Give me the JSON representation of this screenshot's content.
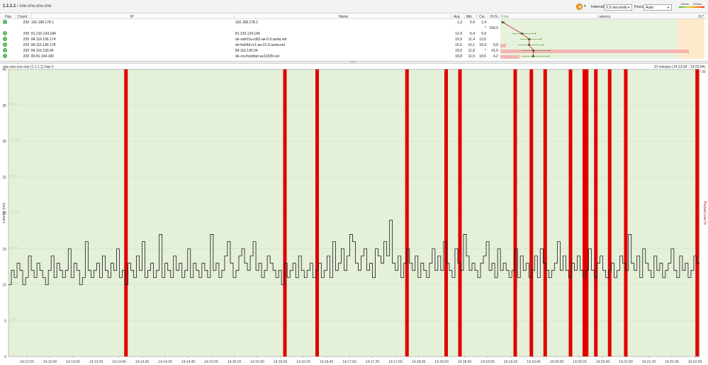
{
  "toolbar": {
    "title_bold": "1.1.1.1",
    "title_rest": " / one.one.one.one",
    "interval_label": "Interval",
    "interval_value": "2.5 seconds",
    "focus_label": "Focus",
    "focus_value": "Auto",
    "scale_100": "100ms",
    "scale_200": "200ms",
    "accent_color": "#f39c12"
  },
  "table": {
    "headers": {
      "hop": "Hop",
      "count": "Count",
      "ip": "IP",
      "name": "Name",
      "avg": "Avg",
      "min": "Min",
      "cur": "Cur",
      "pl": "PL%",
      "zero_ms": "0 ms",
      "latency": "Latency",
      "max_ms": "117"
    },
    "rows": [
      {
        "hop": "1",
        "count": "239",
        "ip": "192.168.178.1",
        "name": "192.168.178.1",
        "avg": "1,3",
        "min": "0,4",
        "cur": "1,4",
        "pl": ""
      },
      {
        "hop": "",
        "count": "",
        "ip": "-",
        "name": "",
        "avg": "",
        "min": "",
        "cur": "*",
        "pl": "100,0"
      },
      {
        "hop": "3",
        "count": "239",
        "ip": "81.210.134.184",
        "name": "81.210.134.184",
        "avg": "12,4",
        "min": "6,4",
        "cur": "9,9",
        "pl": ""
      },
      {
        "hop": "4",
        "count": "239",
        "ip": "84.116.196.174",
        "name": "de-sah01a-rd02-ae-0-0.aorta.net",
        "avg": "16,6",
        "min": "11,4",
        "cur": "13,6",
        "pl": ""
      },
      {
        "hop": "5",
        "count": "239",
        "ip": "84.116.196.178",
        "name": "de-fra04d-rc1-ae-21-0.aorta.net",
        "avg": "16,5",
        "min": "10,1",
        "cur": "16,9",
        "pl": "0,8"
      },
      {
        "hop": "6",
        "count": "239",
        "ip": "84.116.190.94",
        "name": "84.116.190.94",
        "avg": "19,0",
        "min": "11,8",
        "cur": "*",
        "pl": "41,5"
      },
      {
        "hop": "7",
        "count": "239",
        "ip": "80.81.194.180",
        "name": "de-cix-frankfurt.as13335.net",
        "avg": "18,8",
        "min": "11,9",
        "cur": "18,5",
        "pl": "4,2"
      }
    ]
  },
  "chart_header": {
    "title": "one.one.one.one (1.1.1.1) hop 0",
    "range": "10 minutes (14:12:04 - 14:22:04)"
  },
  "chart_data": {
    "type": "line",
    "ylabel_left": "Latency (ms)",
    "ylabel_right": "Packet Loss %",
    "ylim_left": [
      0,
      40
    ],
    "ylim_right": [
      0,
      30
    ],
    "left_ticks": [
      "40",
      "35",
      "30",
      "25",
      "20",
      "15",
      "10",
      "5",
      "0"
    ],
    "right_ticks": [
      "30"
    ],
    "x_ticks": [
      "14:12:20",
      "14:12:40",
      "14:13:00",
      "14:13:20",
      "14:13:40",
      "14:14:00",
      "14:14:20",
      "14:14:40",
      "14:15:00",
      "14:15:20",
      "14:15:40",
      "14:16:00",
      "14:16:20",
      "14:16:40",
      "14:17:00",
      "14:17:20",
      "14:17:40",
      "14:18:00",
      "14:18:20",
      "14:18:40",
      "14:19:00",
      "14:19:20",
      "14:19:40",
      "14:20:00",
      "14:20:20",
      "14:20:40",
      "14:21:00",
      "14:21:20",
      "14:21:40",
      "14:22:00"
    ],
    "loss_times_s": [
      51,
      120,
      134,
      173,
      190,
      196,
      220,
      227,
      233,
      244,
      250,
      251,
      255,
      261,
      268,
      299
    ],
    "latency_ms": [
      10,
      12,
      11,
      13,
      12,
      10,
      11,
      14,
      12,
      11,
      13,
      12,
      11,
      10,
      12,
      14,
      11,
      13,
      12,
      11,
      12,
      15,
      11,
      13,
      12,
      10,
      11,
      16,
      12,
      11,
      12,
      13,
      11,
      14,
      12,
      11,
      13,
      12,
      15,
      11,
      12,
      10,
      13,
      12,
      11,
      14,
      12,
      16,
      11,
      12,
      13,
      11,
      12,
      17,
      11,
      13,
      12,
      11,
      14,
      12,
      13,
      11,
      12,
      15,
      11,
      13,
      12,
      11,
      13,
      12,
      11,
      17,
      12,
      13,
      11,
      12,
      14,
      16,
      13,
      11,
      12,
      14,
      15,
      13,
      12,
      14,
      16,
      12,
      13,
      11,
      12,
      14,
      13,
      12,
      11,
      12,
      10,
      13,
      11,
      12,
      13,
      11,
      14,
      12,
      11,
      12,
      13,
      11,
      12,
      13,
      11,
      12,
      14,
      11,
      16,
      12,
      13,
      15,
      12,
      14,
      17,
      16,
      13,
      12,
      14,
      15,
      12,
      13,
      11,
      15,
      14,
      13,
      16,
      14,
      19,
      13,
      12,
      14,
      11,
      13,
      15,
      13,
      12,
      14,
      11,
      13,
      12,
      11,
      13,
      15,
      12,
      14,
      12,
      16,
      13,
      12,
      11,
      15,
      13,
      12,
      17,
      14,
      12,
      13,
      12,
      11,
      13,
      14,
      16,
      12,
      13,
      11,
      15,
      12,
      13,
      12,
      11,
      12,
      15,
      11,
      14,
      12,
      13,
      11,
      12,
      14,
      11,
      15,
      13,
      12,
      11,
      12,
      13,
      16,
      12,
      14,
      12,
      11,
      13,
      12,
      14,
      12,
      11,
      12,
      15,
      12,
      11,
      13,
      14,
      12,
      11,
      12,
      13,
      11,
      12,
      14,
      13,
      12,
      17,
      13,
      12,
      14,
      11,
      15,
      13,
      12,
      11,
      14,
      12,
      13,
      11,
      12,
      13,
      15,
      12,
      11,
      14,
      12,
      13,
      11,
      12,
      14,
      13
    ],
    "grid": true,
    "line_color": "#1a1a1a",
    "loss_color": "#e00000",
    "background_color": "#e4f0d8"
  }
}
